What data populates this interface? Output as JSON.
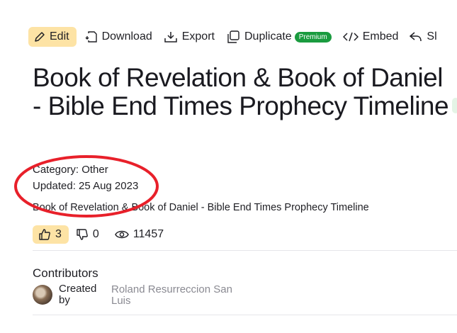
{
  "toolbar": {
    "edit": "Edit",
    "download": "Download",
    "export": "Export",
    "duplicate": "Duplicate",
    "premium_badge": "Premium",
    "embed": "Embed",
    "share_partial": "Sl"
  },
  "page": {
    "title": "Book of Revelation & Book of Daniel - Bible End Times Prophecy Timeline",
    "category": "Category: Other",
    "updated": "Updated: 25 Aug 2023",
    "description": "Book of Revelation & Book of Daniel - Bible End Times Prophecy Timeline"
  },
  "stats": {
    "likes": "3",
    "dislikes": "0",
    "views": "11457"
  },
  "contributors": {
    "heading": "Contributors",
    "created_by_label": "Created by",
    "author": "Roland Resurreccion San Luis"
  },
  "colors": {
    "accent_highlight": "#fde3a5",
    "premium_badge": "#1a9b3f",
    "annotation_circle": "#e8202a"
  }
}
